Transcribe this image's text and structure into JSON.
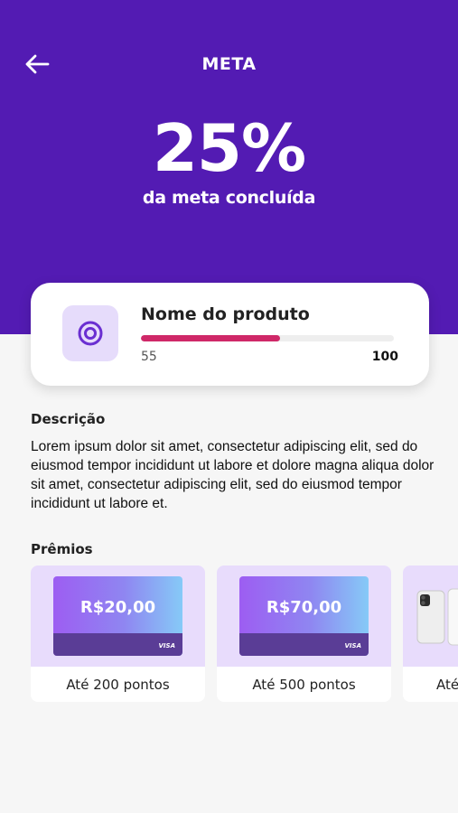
{
  "header": {
    "title": "META",
    "back_icon": "arrow-left-icon",
    "background_color": "#531bb3"
  },
  "progress_summary": {
    "percent_label": "25%",
    "subtitle": "da meta concluída"
  },
  "product": {
    "name": "Nome do produto",
    "icon": "target-icon",
    "current": "55",
    "target": "100",
    "progress_fraction": 0.55,
    "bar_color": "#cf2868"
  },
  "description": {
    "title": "Descrição",
    "text": "Lorem ipsum dolor sit amet, consectetur adipiscing elit, sed do eiusmod tempor incididunt ut labore et dolore magna aliqua dolor sit amet, consectetur adipiscing elit, sed do eiusmod tempor incididunt ut labore et."
  },
  "prizes": {
    "title": "Prêmios",
    "items": [
      {
        "amount": "R$20,00",
        "brand": "VISA",
        "label": "Até 200 pontos"
      },
      {
        "amount": "R$70,00",
        "brand": "VISA",
        "label": "Até 500 pontos"
      },
      {
        "image": "smartphone-image",
        "label": "Até"
      }
    ]
  }
}
